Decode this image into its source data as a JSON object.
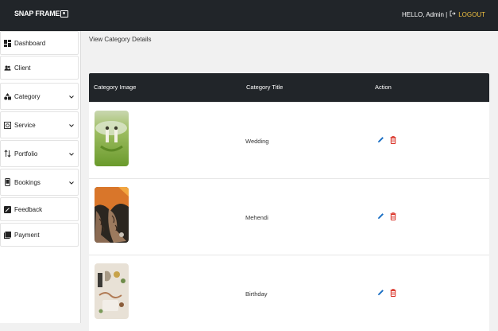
{
  "header": {
    "brand": "SNAP FRAME",
    "greeting": "HELLO, Admin |",
    "logout_label": "LOGOUT"
  },
  "sidebar": {
    "items": [
      {
        "label": "Dashboard",
        "icon": "dashboard-icon",
        "dropdown": false
      },
      {
        "label": "Client",
        "icon": "users-icon",
        "dropdown": false
      },
      {
        "label": "Category",
        "icon": "shapes-icon",
        "dropdown": true
      },
      {
        "label": "Service",
        "icon": "camera-icon",
        "dropdown": true
      },
      {
        "label": "Portfolio",
        "icon": "sort-arrows-icon",
        "dropdown": true
      },
      {
        "label": "Bookings",
        "icon": "phone-icon",
        "dropdown": true
      },
      {
        "label": "Feedback",
        "icon": "feedback-icon",
        "dropdown": false
      },
      {
        "label": "Payment",
        "icon": "book-icon",
        "dropdown": false
      }
    ]
  },
  "page": {
    "breadcrumb": "View Category Details"
  },
  "table": {
    "columns": [
      "Category Image",
      "Category Title",
      "Action"
    ],
    "rows": [
      {
        "title": "Wedding",
        "image": "wedding-photo"
      },
      {
        "title": "Mehendi",
        "image": "mehendi-photo"
      },
      {
        "title": "Birthday",
        "image": "birthday-photo"
      }
    ]
  },
  "colors": {
    "topbar": "#212529",
    "logout": "#f0c040",
    "edit": "#1a6fc4",
    "delete": "#d93025"
  }
}
